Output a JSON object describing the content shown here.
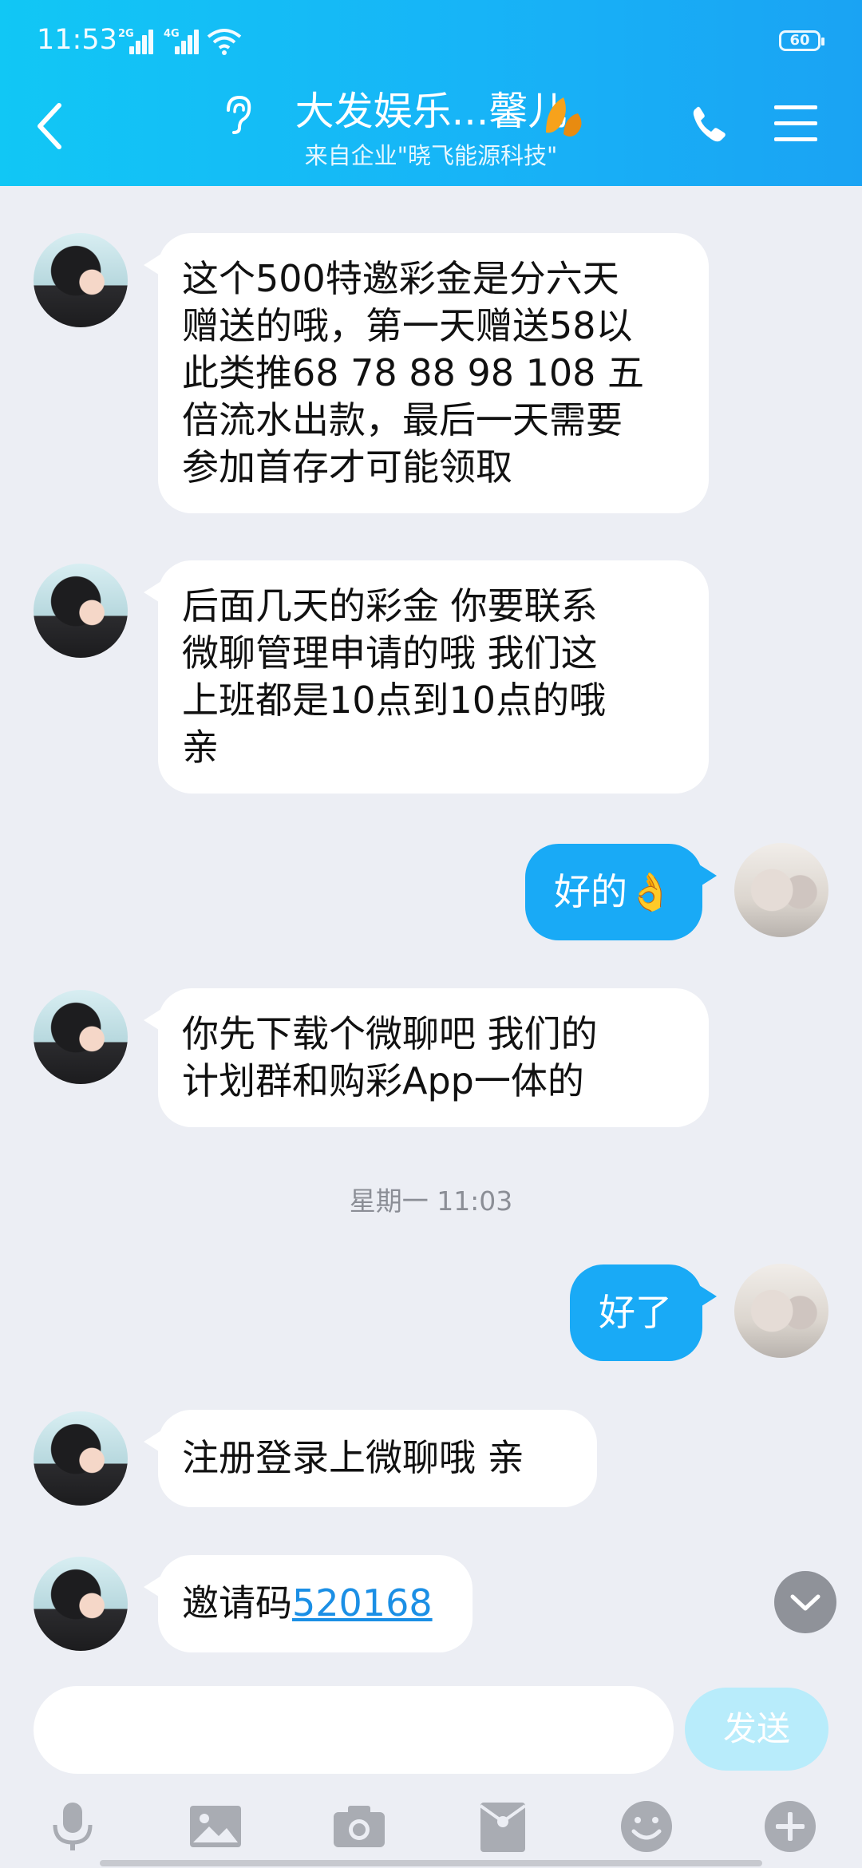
{
  "status_bar": {
    "time": "11:53",
    "net1": "2G",
    "net2": "4G",
    "battery": "60"
  },
  "header": {
    "title": "大发娱乐...馨儿",
    "subtitle": "来自企业\"晓飞能源科技\"",
    "accent_color": "#17b4f7"
  },
  "messages": [
    {
      "side": "in",
      "text": "这个500特邀彩金是分六天\n赠送的哦，第一天赠送58以\n此类推68 78 88 98 108 五\n倍流水出款，最后一天需要\n参加首存才可能领取"
    },
    {
      "side": "in",
      "text": "后面几天的彩金 你要联系\n微聊管理申请的哦  我们这\n上班都是10点到10点的哦\n亲"
    },
    {
      "side": "out",
      "text": "好的👌"
    },
    {
      "side": "in",
      "text": "你先下载个微聊吧 我们的\n计划群和购彩App一体的"
    },
    {
      "side": "out",
      "text": "好了"
    },
    {
      "side": "in",
      "text": "注册登录上微聊哦 亲"
    },
    {
      "side": "in",
      "prefix": "邀请码",
      "link": "520168"
    }
  ],
  "timestamp": "星期一 11:03",
  "composer": {
    "placeholder": "",
    "send_label": "发送"
  },
  "toolbar_icons": [
    "mic-icon",
    "image-icon",
    "camera-icon",
    "red-packet-icon",
    "emoji-icon",
    "plus-icon"
  ]
}
